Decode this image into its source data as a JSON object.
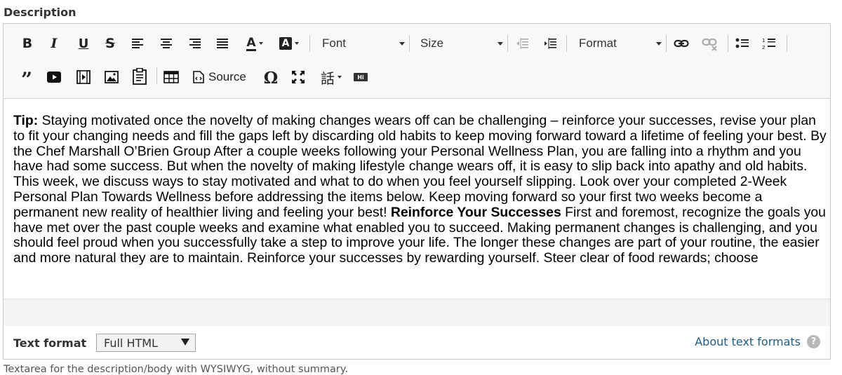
{
  "field": {
    "label": "Description",
    "help_text": "Textarea for the description/body with WYSIWYG, without summary."
  },
  "toolbar": {
    "font_label": "Font",
    "size_label": "Size",
    "format_label": "Format",
    "source_label": "Source",
    "omega": "Ω",
    "zh": "話",
    "hi_badge": "Hi",
    "buttons_row1": [
      "bold-icon",
      "italic-icon",
      "underline-icon",
      "strikethrough-icon",
      "align-left-icon",
      "align-center-icon",
      "align-right-icon",
      "justify-icon",
      "text-color-icon",
      "background-color-icon",
      "font-combo",
      "size-combo",
      "outdent-icon",
      "indent-icon",
      "format-combo",
      "link-icon",
      "unlink-icon",
      "bulleted-list-icon",
      "numbered-list-icon"
    ],
    "buttons_row2": [
      "blockquote-icon",
      "youtube-icon",
      "video-icon",
      "image-icon",
      "paste-from-word-icon",
      "table-icon",
      "source-icon",
      "special-character-icon",
      "maximize-icon",
      "language-icon",
      "hi-badge-icon"
    ]
  },
  "content": {
    "segments": [
      {
        "bold": true,
        "text": "Tip:"
      },
      {
        "bold": false,
        "text": " Staying motivated once the novelty of making changes wears off can be challenging – reinforce your successes, revise your plan to fit your changing needs and fill the gaps left by discarding old habits to keep moving forward toward a lifetime of feeling your best. By the Chef Marshall O’Brien Group After a couple weeks following your Personal Wellness Plan, you are falling into a rhythm and you have had some success. But when the novelty of making lifestyle change wears off, it is easy to slip back into apathy and old habits. This week, we discuss ways to stay motivated and what to do when you feel yourself slipping. Look over your completed 2-Week Personal Plan Towards Wellness before addressing the items below. Keep moving forward so your first two weeks become a permanent new reality of healthier living and feeling your best! "
      },
      {
        "bold": true,
        "text": "Reinforce Your Successes"
      },
      {
        "bold": false,
        "text": " First and foremost, recognize the goals you have met over the past couple weeks and examine what enabled you to succeed. Making permanent changes is challenging, and you should feel proud when you successfully take a step to improve your life. The longer these changes are part of your routine, the easier and more natural they are to maintain. Reinforce your successes by rewarding yourself. Steer clear of food rewards; choose"
      }
    ]
  },
  "text_format": {
    "label": "Text format",
    "selected": "Full HTML",
    "about_link": "About text formats",
    "help_icon": "?"
  }
}
